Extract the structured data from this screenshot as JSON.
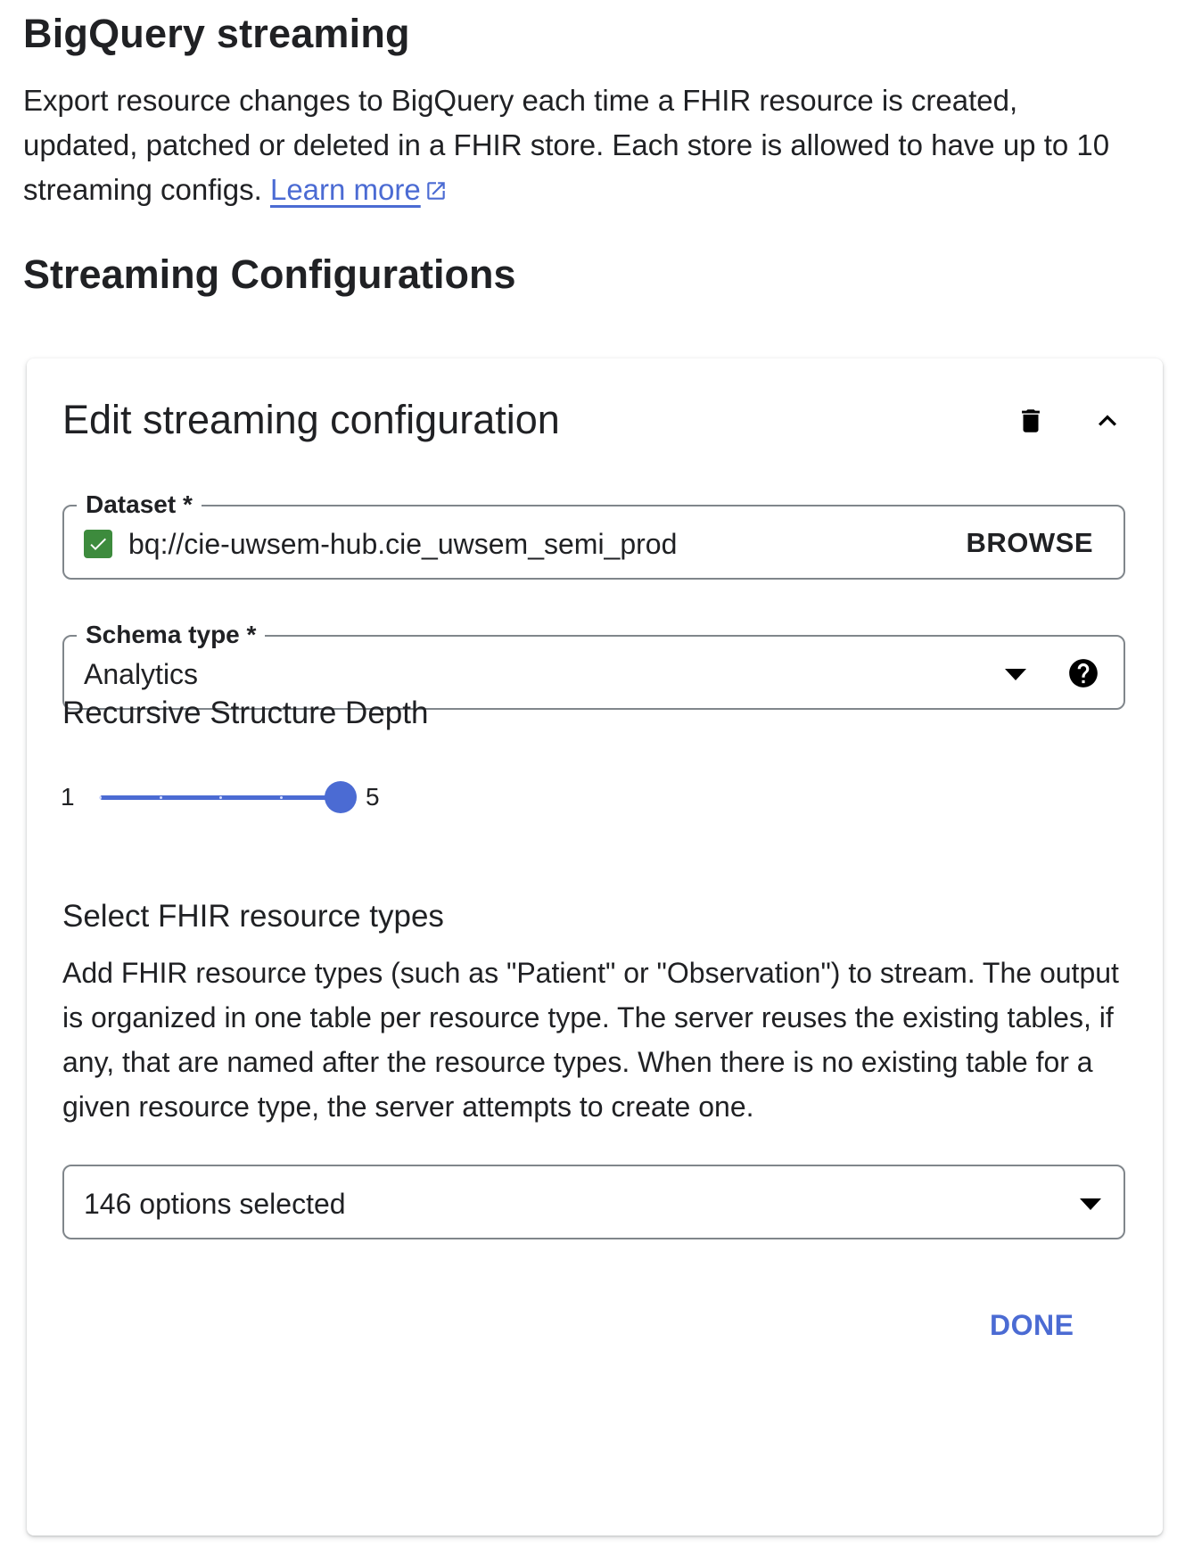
{
  "header": {
    "title": "BigQuery streaming",
    "description": "Export resource changes to BigQuery each time a FHIR resource is created, updated, patched or deleted in a FHIR store. Each store is allowed to have up to 10 streaming configs.",
    "learn_more_label": "Learn more",
    "learn_more_icon": "open-in-new-icon"
  },
  "section": {
    "title": "Streaming Configurations"
  },
  "card": {
    "title": "Edit streaming configuration",
    "delete_icon": "trash-icon",
    "collapse_icon": "chevron-up-icon",
    "dataset": {
      "label": "Dataset *",
      "value": "bq://cie-uwsem-hub.cie_uwsem_semi_prod",
      "valid": true,
      "browse_label": "BROWSE"
    },
    "schema_type": {
      "label": "Schema type *",
      "value": "Analytics",
      "dropdown_icon": "dropdown-arrow-icon",
      "help_icon": "help-icon"
    },
    "recursive_depth": {
      "title": "Recursive Structure Depth",
      "min_label": "1",
      "max_label": "5",
      "min": 1,
      "max": 5,
      "value": 5
    },
    "fhir_resources": {
      "title": "Select FHIR resource types",
      "description": "Add FHIR resource types (such as \"Patient\" or \"Observation\") to stream. The output is organized in one table per resource type. The server reuses the existing tables, if any, that are named after the resource types. When there is no existing table for a given resource type, the server attempts to create one.",
      "selected_summary": "146 options selected"
    },
    "done_label": "DONE"
  },
  "colors": {
    "accent": "#4b6bd3",
    "check": "#3d8b3d",
    "text": "#202124",
    "border": "#80868b"
  }
}
